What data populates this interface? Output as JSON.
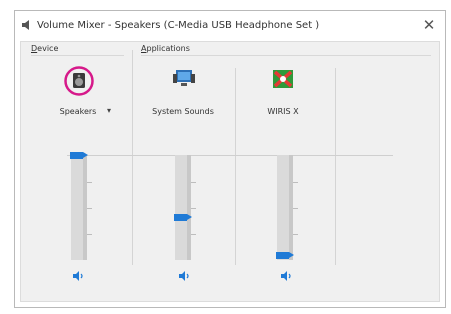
{
  "window": {
    "title": "Volume Mixer - Speakers (C-Media USB Headphone Set )",
    "close_symbol": "✕"
  },
  "sections": {
    "device_label_first": "D",
    "device_label_rest": "evice",
    "applications_label_first": "A",
    "applications_label_rest": "pplications"
  },
  "columns": [
    {
      "name": "Speakers",
      "icon": "speaker-device-icon",
      "level": 1.0,
      "has_dropdown": true
    },
    {
      "name": "System Sounds",
      "icon": "system-sounds-icon",
      "level": 0.38
    },
    {
      "name": "WIRIS X",
      "icon": "wiris-app-icon",
      "level": 0.0
    }
  ],
  "dropdown_symbol": "▾",
  "accent_color": "#1f7ad6",
  "highlight_ring_color": "#d6198a"
}
